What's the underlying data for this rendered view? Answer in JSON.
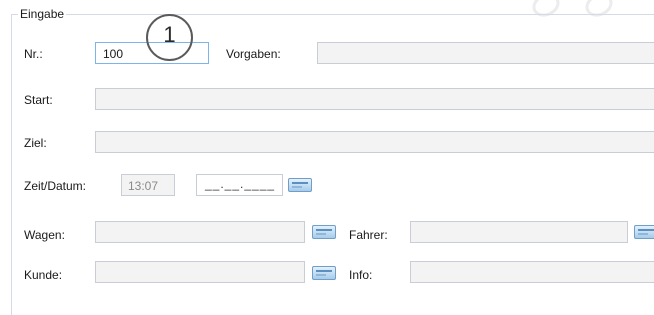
{
  "group": {
    "legend": "Eingabe"
  },
  "callout": "1",
  "fields": {
    "nr": {
      "label": "Nr.:",
      "value": "100"
    },
    "vorgaben": {
      "label": "Vorgaben:",
      "value": ""
    },
    "start": {
      "label": "Start:",
      "value": ""
    },
    "ziel": {
      "label": "Ziel:",
      "value": ""
    },
    "zeit": {
      "label": "Zeit/Datum:",
      "time": "13:07",
      "date_mask": "__.__.____"
    },
    "wagen": {
      "label": "Wagen:",
      "value": ""
    },
    "fahrer": {
      "label": "Fahrer:",
      "value": ""
    },
    "kunde": {
      "label": "Kunde:",
      "value": ""
    },
    "info": {
      "label": "Info:",
      "value": ""
    }
  },
  "icons": {
    "picker": "lookup-button-icon"
  }
}
